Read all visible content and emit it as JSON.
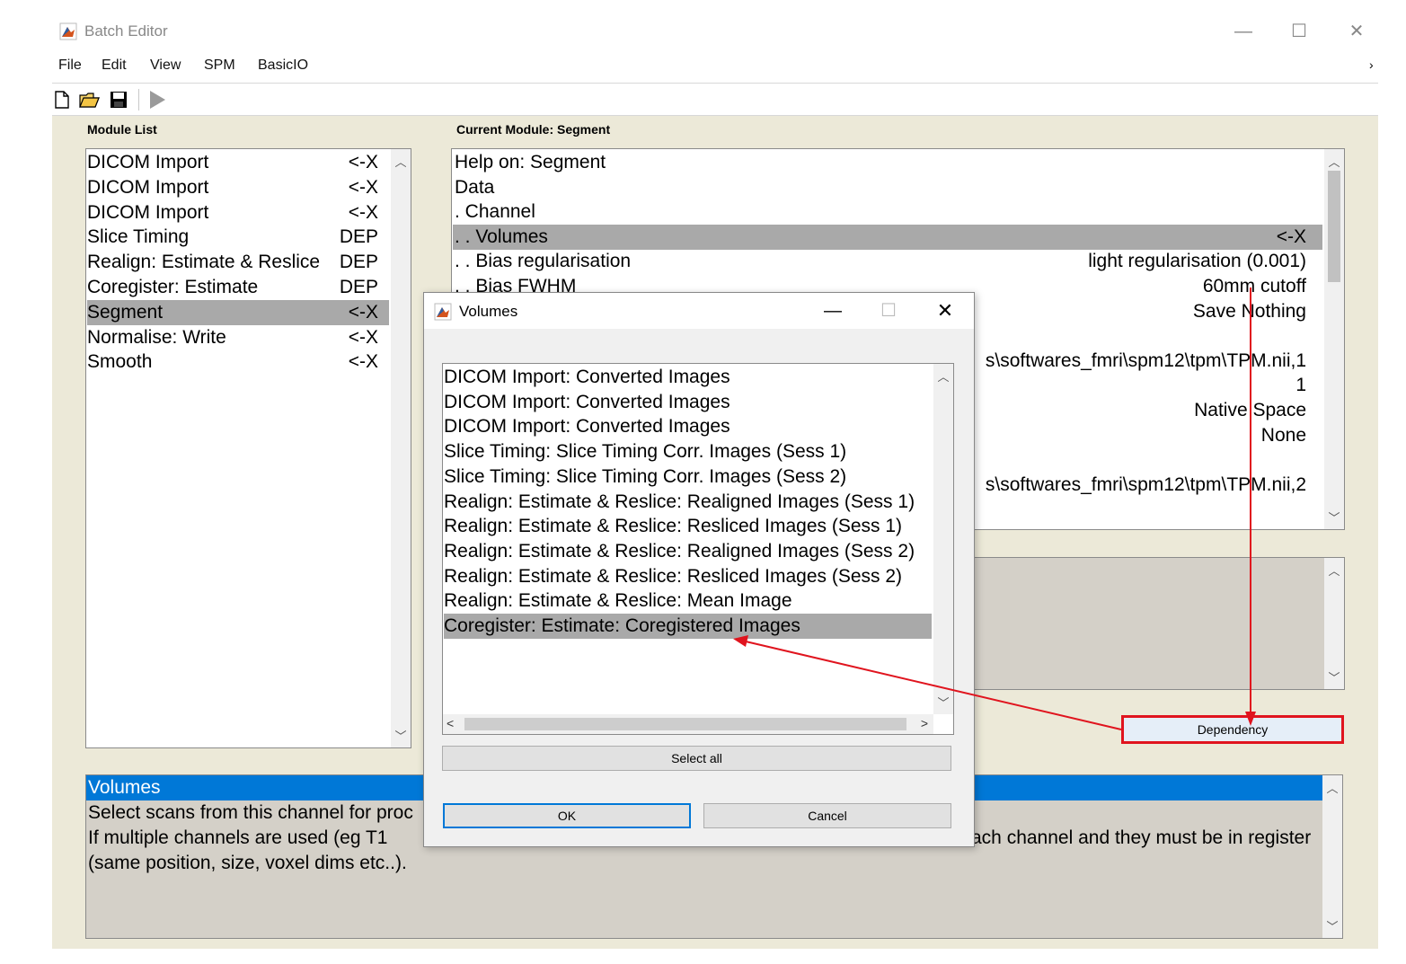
{
  "window": {
    "title": "Batch Editor",
    "controls": {
      "minimize": "—",
      "maximize": "☐",
      "close": "✕"
    }
  },
  "menu": [
    "File",
    "Edit",
    "View",
    "SPM",
    "BasicIO"
  ],
  "module_list": {
    "label": "Module List",
    "items": [
      {
        "name": "DICOM Import",
        "status": "<-X"
      },
      {
        "name": "DICOM Import",
        "status": "<-X"
      },
      {
        "name": "DICOM Import",
        "status": "<-X"
      },
      {
        "name": "Slice Timing",
        "status": "DEP"
      },
      {
        "name": "Realign: Estimate & Reslice",
        "status": "DEP"
      },
      {
        "name": "Coregister: Estimate",
        "status": "DEP"
      },
      {
        "name": "Segment",
        "status": "<-X",
        "selected": true
      },
      {
        "name": "Normalise: Write",
        "status": "<-X"
      },
      {
        "name": "Smooth",
        "status": "<-X"
      }
    ]
  },
  "current_module": {
    "label": "Current Module: Segment",
    "rows": [
      {
        "left": "Help on: Segment",
        "right": ""
      },
      {
        "left": "Data",
        "right": ""
      },
      {
        "left": ". Channel",
        "right": ""
      },
      {
        "left": ". . Volumes",
        "right": "<-X",
        "selected": true
      },
      {
        "left": ". . Bias regularisation",
        "right": "light regularisation (0.001)"
      },
      {
        "left": ". . Bias FWHM",
        "right": "60mm cutoff"
      },
      {
        "left": "",
        "right": "Save Nothing"
      },
      {
        "left": "",
        "right": ""
      },
      {
        "left": "",
        "right": "s\\softwares_fmri\\spm12\\tpm\\TPM.nii,1"
      },
      {
        "left": "",
        "right": "1"
      },
      {
        "left": "",
        "right": "Native Space"
      },
      {
        "left": "",
        "right": "None"
      },
      {
        "left": "",
        "right": ""
      },
      {
        "left": "",
        "right": "s\\softwares_fmri\\spm12\\tpm\\TPM.nii,2"
      }
    ]
  },
  "dependency_button": "Dependency",
  "help": {
    "title": "Volumes",
    "lines": [
      "Select scans from this channel for proc",
      "If  multiple  channels  are  used  (eg  T1",
      "(same position, size, voxel dims etc..)."
    ],
    "line2_tail": "ach channel and they must be in register"
  },
  "dialog": {
    "title": "Volumes",
    "controls": {
      "minimize": "—",
      "maximize": "☐",
      "close": "✕"
    },
    "items": [
      "DICOM Import: Converted Images",
      "DICOM Import: Converted Images",
      "DICOM Import: Converted Images",
      "Slice Timing: Slice Timing Corr. Images (Sess 1)",
      "Slice Timing: Slice Timing Corr. Images (Sess 2)",
      "Realign: Estimate & Reslice: Realigned Images (Sess 1)",
      "Realign: Estimate & Reslice: Resliced Images (Sess 1)",
      "Realign: Estimate & Reslice: Realigned Images (Sess 2)",
      "Realign: Estimate & Reslice: Resliced Images (Sess 2)",
      "Realign: Estimate & Reslice: Mean Image",
      "Coregister: Estimate: Coregistered Images"
    ],
    "selected_index": 10,
    "select_all": "Select all",
    "ok": "OK",
    "cancel": "Cancel"
  },
  "colors": {
    "accent": "#0078d7",
    "annotation": "#e0141e",
    "selection": "#a9a9a9"
  }
}
